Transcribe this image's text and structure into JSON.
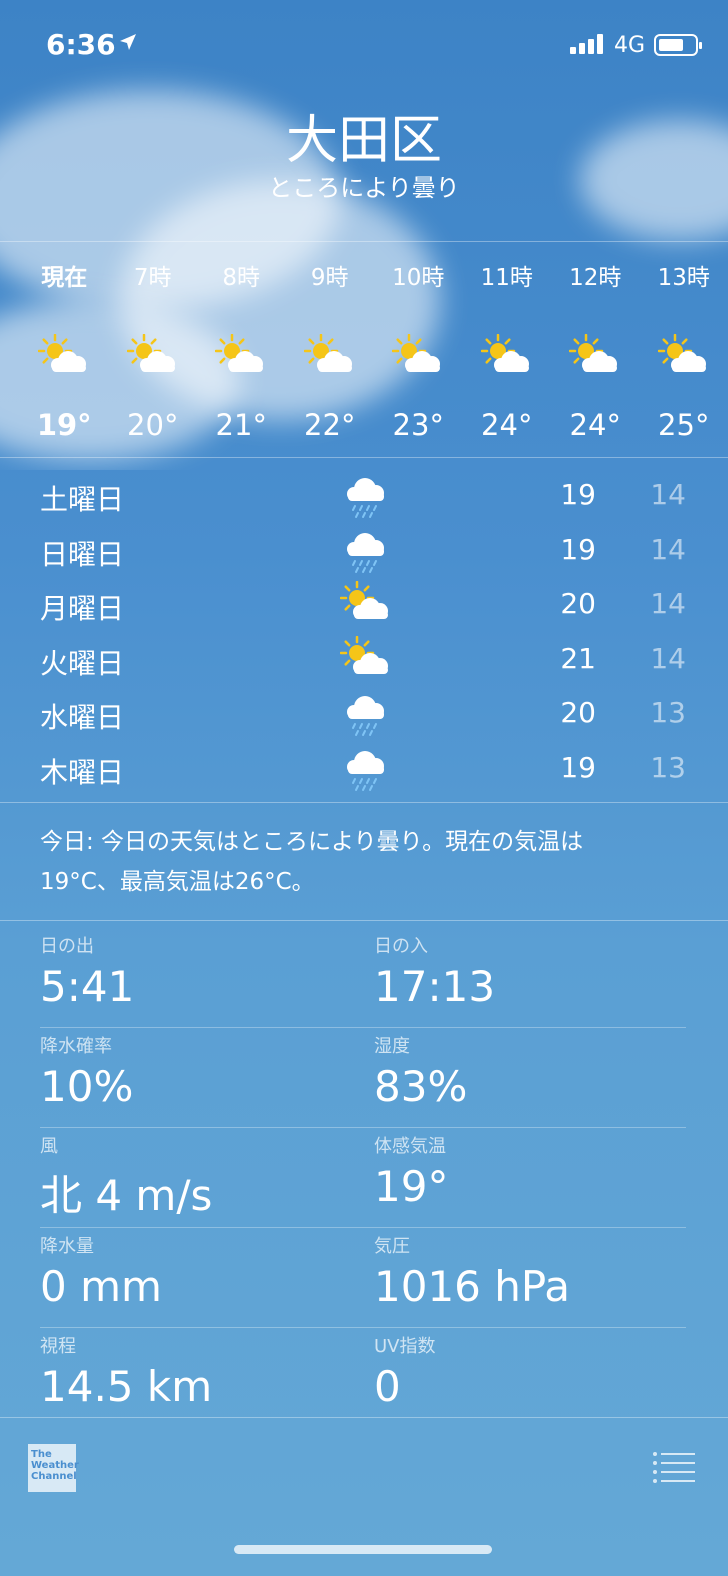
{
  "status": {
    "time": "6:36",
    "network": "4G"
  },
  "location": {
    "city": "大田区",
    "condition": "ところにより曇り"
  },
  "hourly": [
    {
      "label": "現在",
      "icon": "partly-cloudy-icon",
      "temp": "19°"
    },
    {
      "label": "7時",
      "icon": "partly-cloudy-icon",
      "temp": "20°"
    },
    {
      "label": "8時",
      "icon": "partly-cloudy-icon",
      "temp": "21°"
    },
    {
      "label": "9時",
      "icon": "partly-cloudy-icon",
      "temp": "22°"
    },
    {
      "label": "10時",
      "icon": "partly-cloudy-icon",
      "temp": "23°"
    },
    {
      "label": "11時",
      "icon": "partly-cloudy-icon",
      "temp": "24°"
    },
    {
      "label": "12時",
      "icon": "partly-cloudy-icon",
      "temp": "24°"
    },
    {
      "label": "13時",
      "icon": "partly-cloudy-icon",
      "temp": "25°"
    }
  ],
  "daily": [
    {
      "day": "土曜日",
      "icon": "rain-icon",
      "high": "19",
      "low": "14"
    },
    {
      "day": "日曜日",
      "icon": "rain-icon",
      "high": "19",
      "low": "14"
    },
    {
      "day": "月曜日",
      "icon": "partly-cloudy-icon",
      "high": "20",
      "low": "14"
    },
    {
      "day": "火曜日",
      "icon": "partly-cloudy-icon",
      "high": "21",
      "low": "14"
    },
    {
      "day": "水曜日",
      "icon": "rain-icon",
      "high": "20",
      "low": "13"
    },
    {
      "day": "木曜日",
      "icon": "rain-icon",
      "high": "19",
      "low": "13"
    }
  ],
  "summary": {
    "line1": "今日: 今日の天気はところにより曇り。現在の気温は",
    "line2": "19°C、最高気温は26°C。"
  },
  "details": {
    "sunrise": {
      "label": "日の出",
      "value": "5:41"
    },
    "sunset": {
      "label": "日の入",
      "value": "17:13"
    },
    "precip_chance": {
      "label": "降水確率",
      "value": "10%"
    },
    "humidity": {
      "label": "湿度",
      "value": "83%"
    },
    "wind": {
      "label": "風",
      "value": "北 4 m/s"
    },
    "feels_like": {
      "label": "体感気温",
      "value": "19°"
    },
    "precip": {
      "label": "降水量",
      "value": "0 mm"
    },
    "pressure": {
      "label": "気圧",
      "value": "1016 hPa"
    },
    "visibility": {
      "label": "視程",
      "value": "14.5 km"
    },
    "uv": {
      "label": "UV指数",
      "value": "0"
    }
  },
  "footer": {
    "logo_line1": "The",
    "logo_line2": "Weather",
    "logo_line3": "Channel"
  },
  "colors": {
    "sun": "#f5c518",
    "cloud": "#ffffff",
    "rain": "#7fc4f5"
  }
}
